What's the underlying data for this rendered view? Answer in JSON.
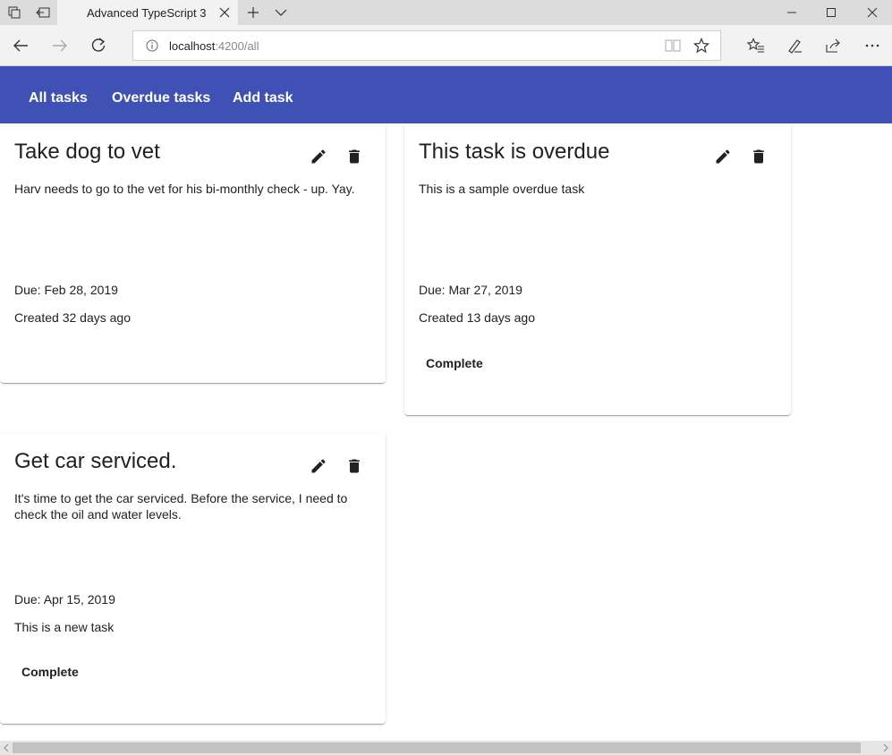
{
  "browser": {
    "tab_title": "Advanced TypeScript 3",
    "url_host": "localhost",
    "url_rest": ":4200/all"
  },
  "app": {
    "nav": [
      "All tasks",
      "Overdue tasks",
      "Add task"
    ],
    "accent": "#3f51b5"
  },
  "tasks": [
    {
      "title": "Take dog to vet",
      "description": "Harv needs to go to the vet for his bi-monthly check - up. Yay.",
      "due": "Due: Feb 28, 2019",
      "created": "Created 32 days ago",
      "complete_label": ""
    },
    {
      "title": "This task is overdue",
      "description": "This is a sample overdue task",
      "due": "Due: Mar 27, 2019",
      "created": "Created 13 days ago",
      "complete_label": "Complete"
    },
    {
      "title": "Get car serviced.",
      "description": "It's time to get the car serviced. Before the service, I need to check the oil and water levels.",
      "due": "Due: Apr 15, 2019",
      "created": "This is a new task",
      "complete_label": "Complete"
    }
  ],
  "icons": {
    "edit": "pencil-icon",
    "delete": "trash-icon"
  }
}
